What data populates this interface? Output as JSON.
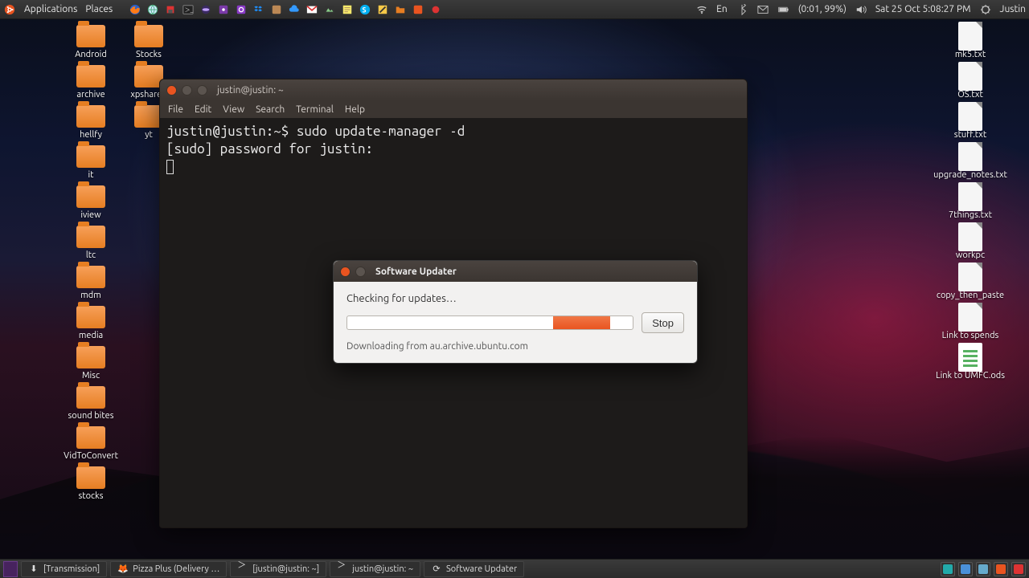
{
  "top_panel": {
    "menus": [
      "Applications",
      "Places"
    ],
    "status": {
      "lang": "En",
      "battery": "(0:01, 99%)",
      "datetime": "Sat 25 Oct  5:08:27 PM",
      "user": "Justin"
    }
  },
  "desktop": {
    "left_col1": [
      "Android",
      "archive",
      "hellfy",
      "it",
      "iview",
      "ltc",
      "mdm",
      "media",
      "Misc",
      "sound bites",
      "VidToConvert",
      "stocks"
    ],
    "left_col2": [
      "Stocks",
      "xpshared",
      "yt"
    ],
    "right_col": [
      {
        "label": "mk5.txt",
        "type": "txt"
      },
      {
        "label": "OS.txt",
        "type": "txt"
      },
      {
        "label": "stuff.txt",
        "type": "txt"
      },
      {
        "label": "upgrade_notes.txt",
        "type": "txt"
      },
      {
        "label": "7things.txt",
        "type": "txt"
      },
      {
        "label": "workpc",
        "type": "txt"
      },
      {
        "label": "copy_then_paste",
        "type": "txt"
      },
      {
        "label": "Link to spends",
        "type": "txt"
      },
      {
        "label": "Link to UMFC.ods",
        "type": "ods"
      }
    ]
  },
  "terminal": {
    "title": "justin@justin: ~",
    "menus": [
      "File",
      "Edit",
      "View",
      "Search",
      "Terminal",
      "Help"
    ],
    "line1": "justin@justin:~$ sudo update-manager -d",
    "line2": "[sudo] password for justin: "
  },
  "updater": {
    "title": "Software Updater",
    "checking": "Checking for updates…",
    "stop": "Stop",
    "status": "Downloading from au.archive.ubuntu.com",
    "bar_left_pct": 72,
    "bar_width_pct": 20
  },
  "bottom_panel": {
    "tasks": [
      {
        "label": "[Transmission]"
      },
      {
        "label": "Pizza Plus (Delivery …"
      },
      {
        "label": "[justin@justin: ~]"
      },
      {
        "label": "justin@justin: ~"
      },
      {
        "label": "Software Updater"
      }
    ]
  }
}
